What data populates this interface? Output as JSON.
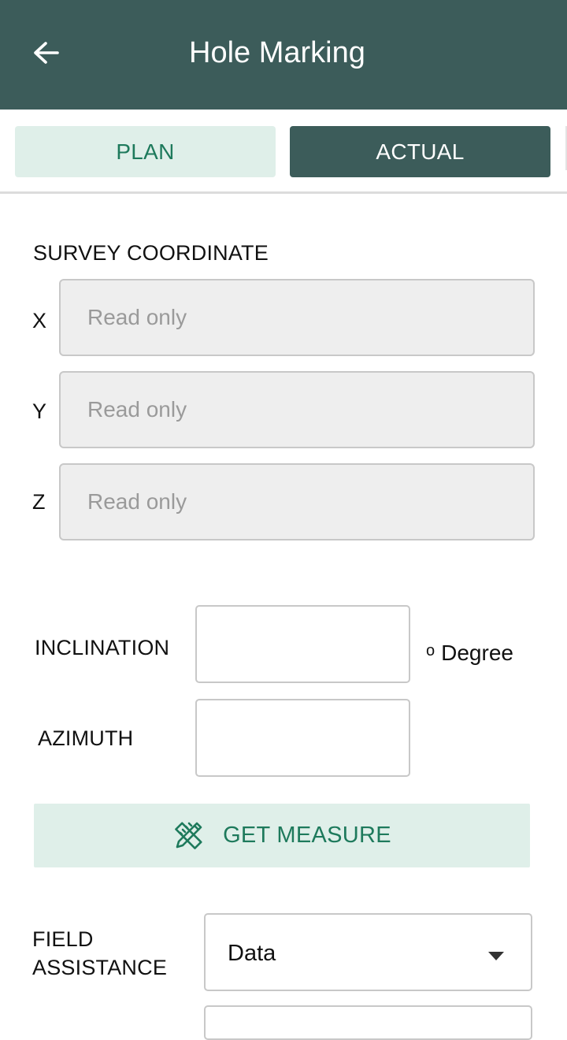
{
  "header": {
    "title": "Hole Marking",
    "back_icon": "arrow-left-icon"
  },
  "tabs": [
    {
      "label": "PLAN",
      "selected": false
    },
    {
      "label": "ACTUAL",
      "selected": true
    }
  ],
  "survey": {
    "title": "SURVEY COORDINATE",
    "fields": [
      {
        "label": "X",
        "placeholder": "Read only",
        "value": ""
      },
      {
        "label": "Y",
        "placeholder": "Read only",
        "value": ""
      },
      {
        "label": "Z",
        "placeholder": "Read only",
        "value": ""
      }
    ]
  },
  "orientation": {
    "inclination_label": "INCLINATION",
    "inclination_value": "",
    "azimuth_label": "AZIMUTH",
    "azimuth_value": "",
    "unit_symbol": "o",
    "unit_label": "Degree"
  },
  "measure_button": {
    "label": "GET MEASURE",
    "icon": "ruler-pencil-icon"
  },
  "field_assistance": {
    "label_line1": "FIELD",
    "label_line2": "ASSISTANCE",
    "selected": "Data"
  },
  "colors": {
    "primary": "#3c5c5a",
    "accent_text": "#1e7a5c",
    "accent_bg": "#dfefe9",
    "readonly_bg": "#eeeeee",
    "border": "#c8c8c8"
  }
}
